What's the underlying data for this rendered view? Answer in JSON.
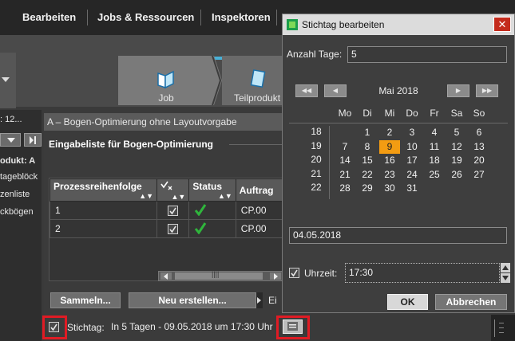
{
  "menu": {
    "items": [
      "Bearbeiten",
      "Jobs & Ressourcen",
      "Inspektoren"
    ]
  },
  "toolbar": {
    "job_label": "Job",
    "part_label": "Teilprodukt"
  },
  "left_panel": {
    "header_text": ": 12...",
    "product_label": "odukt: A",
    "items": [
      "tageblöck",
      "zenliste",
      "ckbögen"
    ]
  },
  "main": {
    "title": "A – Bogen-Optimierung ohne Layoutvorgabe",
    "section_title": "Eingabeliste für Bogen-Optimierung",
    "table": {
      "headers": [
        "Prozessreihenfolge",
        "",
        "Status",
        "Auftrag"
      ],
      "rows": [
        {
          "order": "1",
          "job": "CP.00"
        },
        {
          "order": "2",
          "job": "CP.00"
        }
      ]
    },
    "buttons": {
      "collect": "Sammeln...",
      "create_new": "Neu erstellen...",
      "more": "Ei"
    },
    "deadline": {
      "label": "Stichtag:",
      "text": "In 5 Tagen - 09.05.2018 um 17:30 Uhr"
    }
  },
  "dialog": {
    "title": "Stichtag bearbeiten",
    "close": "✕",
    "days_label": "Anzahl Tage:",
    "days_value": "5",
    "month_label": "Mai 2018",
    "weekdays": [
      "Mo",
      "Di",
      "Mi",
      "Do",
      "Fr",
      "Sa",
      "So"
    ],
    "weeks": [
      {
        "week": "18",
        "days": [
          "",
          "1",
          "2",
          "3",
          "4",
          "5",
          "6"
        ]
      },
      {
        "week": "19",
        "days": [
          "7",
          "8",
          "9",
          "10",
          "11",
          "12",
          "13"
        ]
      },
      {
        "week": "20",
        "days": [
          "14",
          "15",
          "16",
          "17",
          "18",
          "19",
          "20"
        ]
      },
      {
        "week": "21",
        "days": [
          "21",
          "22",
          "23",
          "24",
          "25",
          "26",
          "27"
        ]
      },
      {
        "week": "22",
        "days": [
          "28",
          "29",
          "30",
          "31",
          "",
          "",
          ""
        ]
      }
    ],
    "selected_day": "9",
    "date_value": "04.05.2018",
    "time_label": "Uhrzeit:",
    "time_value": "17:30",
    "ok": "OK",
    "cancel": "Abbrechen",
    "accent_color": "#f39c12"
  }
}
